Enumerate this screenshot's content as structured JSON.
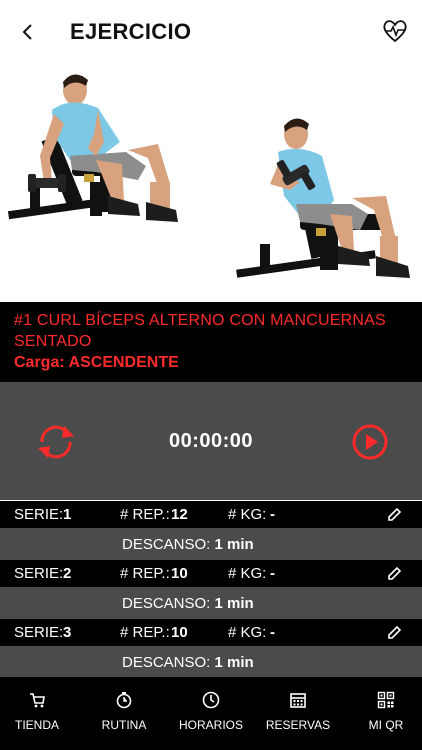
{
  "header": {
    "title": "EJERCICIO",
    "back_icon": "chevron-left-icon",
    "heart_icon": "heart-pulse-icon"
  },
  "exercise": {
    "name": "#1 CURL BÍCEPS ALTERNO CON MANCUERNAS SENTADO",
    "carga_label": "Carga:",
    "carga_value": "ASCENDENTE"
  },
  "timer": {
    "value": "00:00:00",
    "reset_icon": "refresh-icon",
    "play_icon": "play-circle-icon"
  },
  "series": [
    {
      "serie_label": "SERIE:",
      "serie": "1",
      "rep_label": "# REP.:",
      "rep": "12",
      "kg_label": "# KG:",
      "kg": "-",
      "rest_label": "DESCANSO:",
      "rest": "1 min"
    },
    {
      "serie_label": "SERIE:",
      "serie": "2",
      "rep_label": "# REP.:",
      "rep": "10",
      "kg_label": "# KG:",
      "kg": "-",
      "rest_label": "DESCANSO:",
      "rest": "1 min"
    },
    {
      "serie_label": "SERIE:",
      "serie": "3",
      "rep_label": "# REP.:",
      "rep": "10",
      "kg_label": "# KG:",
      "kg": "-",
      "rest_label": "DESCANSO:",
      "rest": "1 min"
    }
  ],
  "nav": [
    {
      "label": "TIENDA",
      "icon": "cart-icon"
    },
    {
      "label": "RUTINA",
      "icon": "stopwatch-icon"
    },
    {
      "label": "HORARIOS",
      "icon": "clock-icon"
    },
    {
      "label": "RESERVAS",
      "icon": "calendar-icon"
    },
    {
      "label": "MI QR",
      "icon": "qr-code-icon"
    }
  ],
  "colors": {
    "accent": "#ff2b2b",
    "panel": "#4b4b4b",
    "shirt": "#7cc8e6"
  }
}
